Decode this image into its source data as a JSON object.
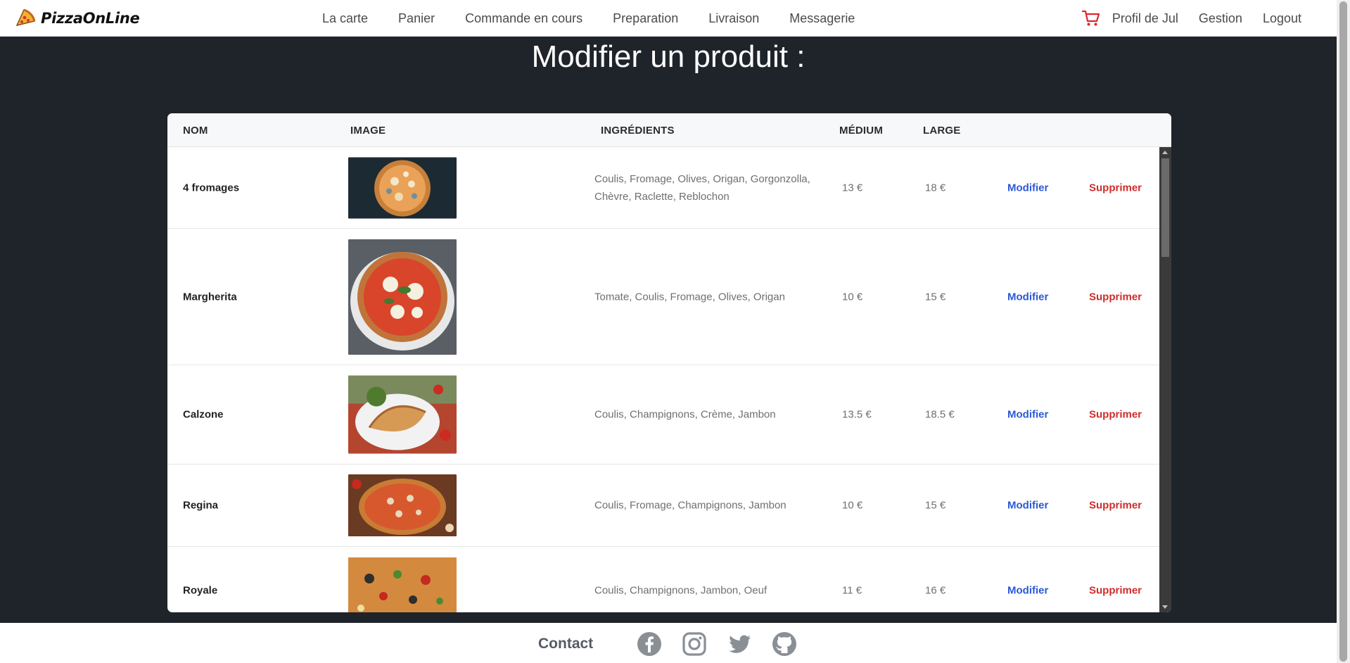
{
  "brand": {
    "name": "PizzaOnLine",
    "logo_icon": "pizza-slice-icon"
  },
  "nav": {
    "links": [
      "La carte",
      "Panier",
      "Commande en cours",
      "Preparation",
      "Livraison",
      "Messagerie"
    ],
    "right": {
      "cart_icon": "cart-icon",
      "profile": "Profil de Jul",
      "gestion": "Gestion",
      "logout": "Logout"
    }
  },
  "page": {
    "title": "Modifier un produit :"
  },
  "table": {
    "headers": {
      "nom": "NOM",
      "image": "IMAGE",
      "ingredients": "INGRÉDIENTS",
      "medium": "MÉDIUM",
      "large": "LARGE"
    },
    "rows": [
      {
        "name": "4 fromages",
        "ingredients": "Coulis, Fromage, Olives, Origan, Gorgonzolla, Chèvre, Raclette, Reblochon",
        "medium": "13 €",
        "large": "18 €",
        "edit": "Modifier",
        "delete": "Supprimer"
      },
      {
        "name": "Margherita",
        "ingredients": "Tomate, Coulis, Fromage, Olives, Origan",
        "medium": "10 €",
        "large": "15 €",
        "edit": "Modifier",
        "delete": "Supprimer"
      },
      {
        "name": "Calzone",
        "ingredients": "Coulis, Champignons, Crème, Jambon",
        "medium": "13.5 €",
        "large": "18.5 €",
        "edit": "Modifier",
        "delete": "Supprimer"
      },
      {
        "name": "Regina",
        "ingredients": "Coulis, Fromage, Champignons, Jambon",
        "medium": "10 €",
        "large": "15 €",
        "edit": "Modifier",
        "delete": "Supprimer"
      },
      {
        "name": "Royale",
        "ingredients": "Coulis, Champignons, Jambon, Oeuf",
        "medium": "11 €",
        "large": "16 €",
        "edit": "Modifier",
        "delete": "Supprimer"
      }
    ]
  },
  "footer": {
    "contact": "Contact",
    "icons": [
      "facebook-icon",
      "instagram-icon",
      "twitter-icon",
      "github-icon"
    ]
  },
  "colors": {
    "edit": "#2b59d6",
    "delete": "#d12b2b",
    "background": "#1f232a",
    "cart": "#e0262c"
  }
}
